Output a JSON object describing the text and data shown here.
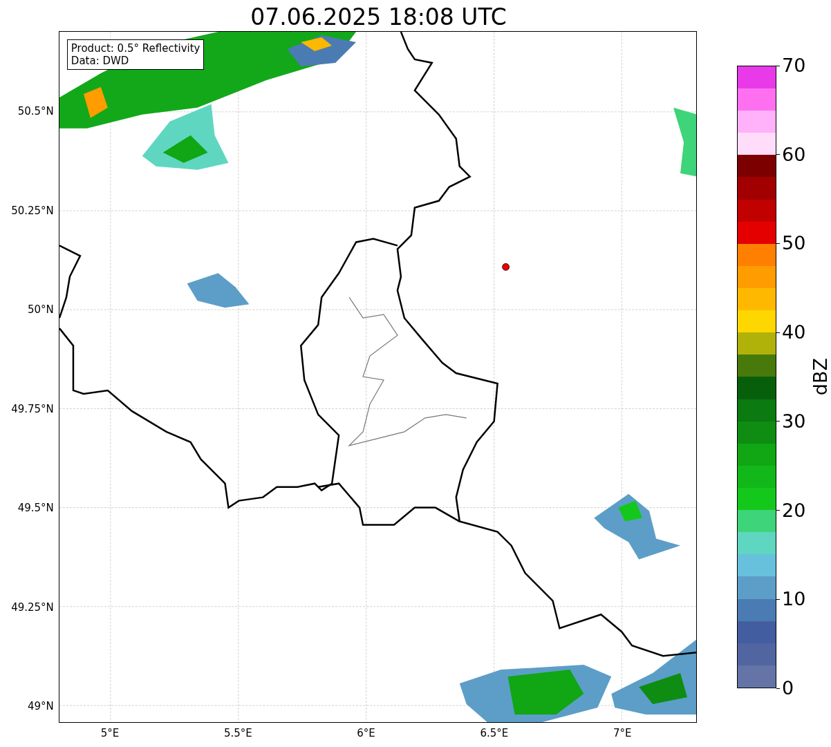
{
  "title": "07.06.2025 18:08 UTC",
  "info_box": {
    "lines": [
      "Product: 0.5° Reflectivity",
      "Data: DWD"
    ]
  },
  "map": {
    "lat_ticks": [
      "50.5°N",
      "50.25°N",
      "50°N",
      "49.75°N",
      "49.5°N",
      "49.25°N",
      "49°N"
    ],
    "lon_ticks": [
      "5°E",
      "5.5°E",
      "6°E",
      "6.5°E",
      "7°E"
    ]
  },
  "colorbar": {
    "label": "dBZ",
    "ticks": [
      "70",
      "60",
      "50",
      "40",
      "30",
      "20",
      "10",
      "0"
    ],
    "segments": [
      {
        "color": "#6474a6"
      },
      {
        "color": "#5165a0"
      },
      {
        "color": "#435ea0"
      },
      {
        "color": "#4b7bb3"
      },
      {
        "color": "#5c9ec8"
      },
      {
        "color": "#67c1dc"
      },
      {
        "color": "#5fd6c0"
      },
      {
        "color": "#3dd47a"
      },
      {
        "color": "#13c81a"
      },
      {
        "color": "#12b81a"
      },
      {
        "color": "#10a614"
      },
      {
        "color": "#0e8d12"
      },
      {
        "color": "#0b7a10"
      },
      {
        "color": "#075f0b"
      },
      {
        "color": "#477a0b"
      },
      {
        "color": "#b0b20a"
      },
      {
        "color": "#ffd700"
      },
      {
        "color": "#ffb800"
      },
      {
        "color": "#ff9c00"
      },
      {
        "color": "#ff8000"
      },
      {
        "color": "#e50000"
      },
      {
        "color": "#c10000"
      },
      {
        "color": "#a20000"
      },
      {
        "color": "#7d0000"
      },
      {
        "color": "#ffdcfa"
      },
      {
        "color": "#ffb1fa"
      },
      {
        "color": "#ff70f0"
      },
      {
        "color": "#e83ae8"
      }
    ]
  }
}
